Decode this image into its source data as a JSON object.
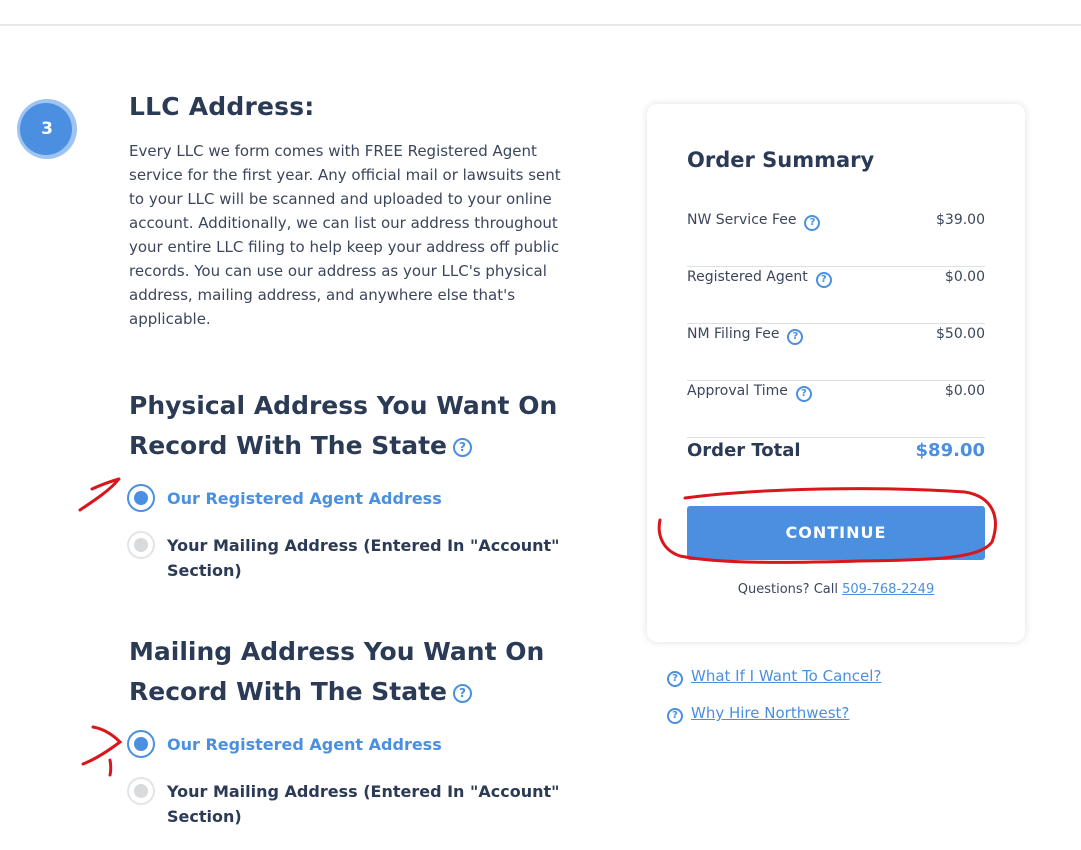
{
  "step": {
    "number": "3"
  },
  "section": {
    "title": "LLC Address:",
    "description": "Every LLC we form comes with FREE Registered Agent service for the first year. Any official mail or lawsuits sent to your LLC will be scanned and uploaded to your online account. Additionally, we can list our address throughout your entire LLC filing to help keep your address off public records. You can use our address as your LLC's physical address, mailing address, and anywhere else that's applicable."
  },
  "physical": {
    "heading": "Physical Address You Want On Record With The State",
    "options": [
      {
        "label": "Our Registered Agent Address",
        "selected": true
      },
      {
        "label": "Your Mailing Address (Entered In \"Account\" Section)",
        "selected": false
      }
    ]
  },
  "mailing": {
    "heading": "Mailing Address You Want On Record With The State",
    "options": [
      {
        "label": "Our Registered Agent Address",
        "selected": true
      },
      {
        "label": "Your Mailing Address (Entered In \"Account\" Section)",
        "selected": false
      }
    ]
  },
  "summary": {
    "title": "Order Summary",
    "fees": [
      {
        "label": "NW Service Fee",
        "value": "$39.00"
      },
      {
        "label": "Registered Agent",
        "value": "$0.00"
      },
      {
        "label": "NM Filing Fee",
        "value": "$50.00"
      },
      {
        "label": "Approval Time",
        "value": "$0.00"
      }
    ],
    "total_label": "Order Total",
    "total_value": "$89.00",
    "continue_label": "CONTINUE",
    "questions_text": "Questions? Call",
    "phone": "509-768-2249"
  },
  "links": {
    "cancel": "What If I Want To Cancel?",
    "why": "Why Hire Northwest?"
  },
  "icons": {
    "help": "help-circle-icon"
  },
  "colors": {
    "accent": "#4a8fe0",
    "heading": "#2b3a55",
    "annotation": "#d8161c"
  }
}
